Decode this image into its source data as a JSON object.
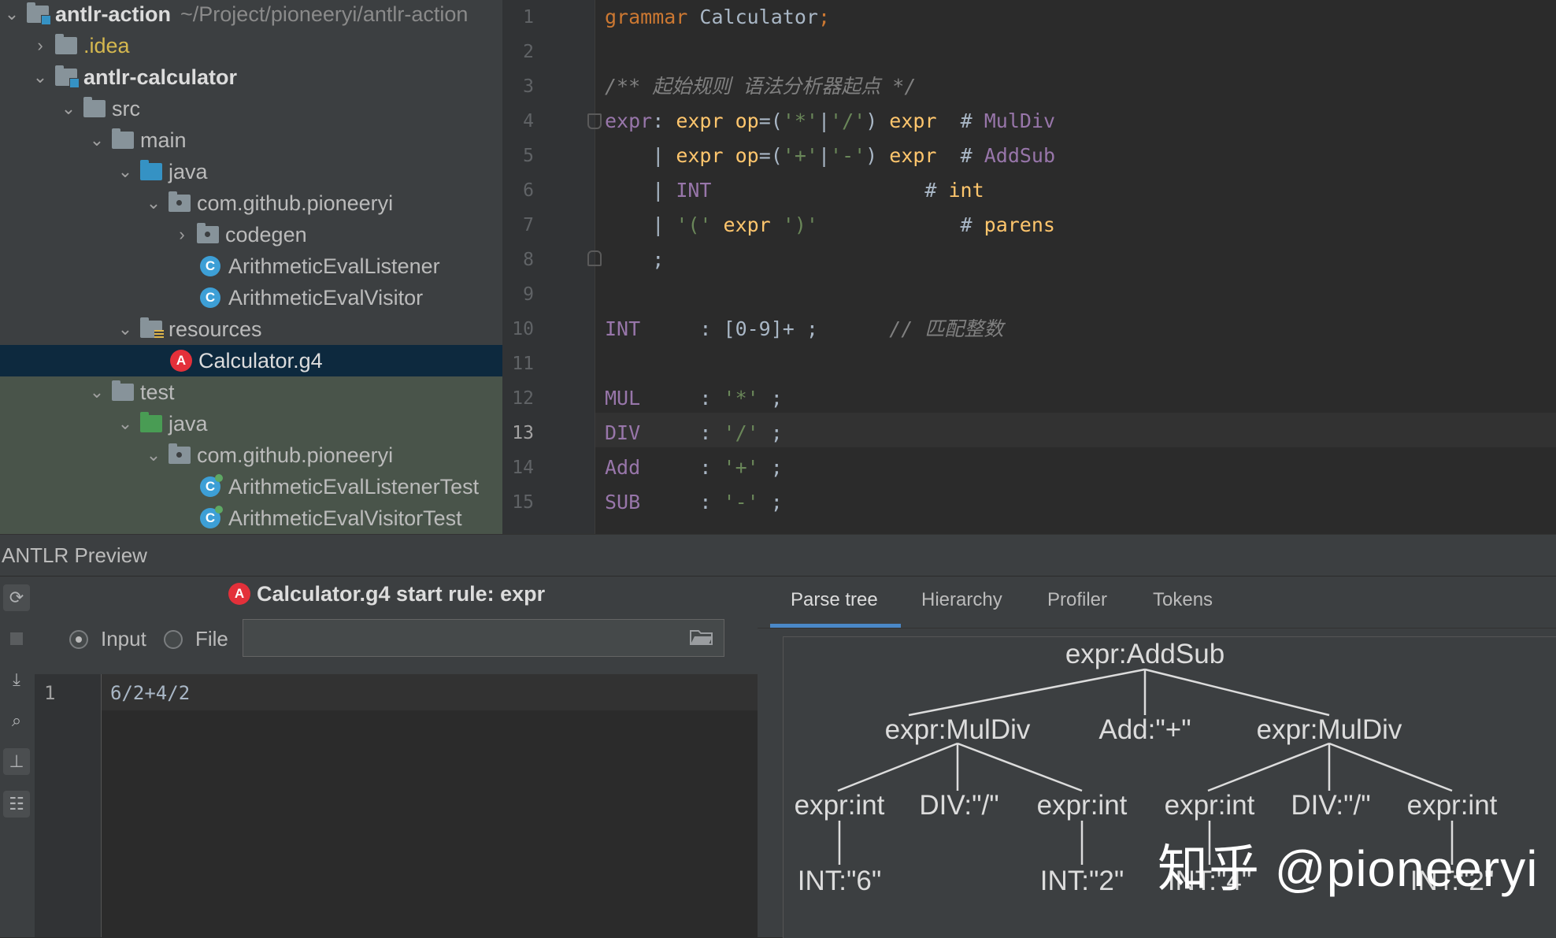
{
  "project_tree": {
    "root": {
      "name": "antlr-action",
      "path": "~/Project/pioneeryi/antlr-action"
    },
    "items": [
      {
        "label": ".idea"
      },
      {
        "label": "antlr-calculator"
      },
      {
        "label": "src"
      },
      {
        "label": "main"
      },
      {
        "label": "java"
      },
      {
        "label": "com.github.pioneeryi"
      },
      {
        "label": "codegen"
      },
      {
        "label": "ArithmeticEvalListener"
      },
      {
        "label": "ArithmeticEvalVisitor"
      },
      {
        "label": "resources"
      },
      {
        "label": "Calculator.g4"
      },
      {
        "label": "test"
      },
      {
        "label": "java"
      },
      {
        "label": "com.github.pioneeryi"
      },
      {
        "label": "ArithmeticEvalListenerTest"
      },
      {
        "label": "ArithmeticEvalVisitorTest"
      }
    ],
    "class_icon_letter": "C",
    "antlr_icon_letter": "A"
  },
  "editor": {
    "line_numbers": [
      "1",
      "2",
      "3",
      "4",
      "5",
      "6",
      "7",
      "8",
      "9",
      "10",
      "11",
      "12",
      "13",
      "14",
      "15"
    ],
    "current_line": "13",
    "lines": [
      [
        {
          "t": "grammar ",
          "c": "or"
        },
        {
          "t": "Calculator",
          "c": "fg"
        },
        {
          "t": ";",
          "c": "or"
        }
      ],
      [],
      [
        {
          "t": "/** 起始规则 语法分析器起点 */",
          "c": "cm"
        }
      ],
      [
        {
          "t": "expr",
          "c": "pu"
        },
        {
          "t": ": ",
          "c": "fg"
        },
        {
          "t": "expr ",
          "c": "ye"
        },
        {
          "t": "op",
          "c": "ye"
        },
        {
          "t": "=(",
          "c": "fg"
        },
        {
          "t": "'*'",
          "c": "gr"
        },
        {
          "t": "|",
          "c": "fg"
        },
        {
          "t": "'/'",
          "c": "gr"
        },
        {
          "t": ") ",
          "c": "fg"
        },
        {
          "t": "expr",
          "c": "ye"
        },
        {
          "t": "  # ",
          "c": "fg"
        },
        {
          "t": "MulDiv",
          "c": "pu"
        }
      ],
      [
        {
          "t": "    | ",
          "c": "fg"
        },
        {
          "t": "expr ",
          "c": "ye"
        },
        {
          "t": "op",
          "c": "ye"
        },
        {
          "t": "=(",
          "c": "fg"
        },
        {
          "t": "'+'",
          "c": "gr"
        },
        {
          "t": "|",
          "c": "fg"
        },
        {
          "t": "'-'",
          "c": "gr"
        },
        {
          "t": ") ",
          "c": "fg"
        },
        {
          "t": "expr",
          "c": "ye"
        },
        {
          "t": "  # ",
          "c": "fg"
        },
        {
          "t": "AddSub",
          "c": "pu"
        }
      ],
      [
        {
          "t": "    | ",
          "c": "fg"
        },
        {
          "t": "INT",
          "c": "pu"
        },
        {
          "t": "                  # ",
          "c": "fg"
        },
        {
          "t": "int",
          "c": "in"
        }
      ],
      [
        {
          "t": "    | ",
          "c": "fg"
        },
        {
          "t": "'('",
          "c": "gr"
        },
        {
          "t": " expr ",
          "c": "ye"
        },
        {
          "t": "')'",
          "c": "gr"
        },
        {
          "t": "            # ",
          "c": "fg"
        },
        {
          "t": "parens",
          "c": "in"
        }
      ],
      [
        {
          "t": "    ;",
          "c": "fg"
        }
      ],
      [],
      [
        {
          "t": "INT",
          "c": "pu"
        },
        {
          "t": "     : [0-9]+ ;      ",
          "c": "fg"
        },
        {
          "t": "// 匹配整数",
          "c": "cm"
        }
      ],
      [],
      [
        {
          "t": "MUL",
          "c": "pu"
        },
        {
          "t": "     : ",
          "c": "fg"
        },
        {
          "t": "'*'",
          "c": "gr"
        },
        {
          "t": " ;",
          "c": "fg"
        }
      ],
      [
        {
          "t": "DIV",
          "c": "pu"
        },
        {
          "t": "     : ",
          "c": "fg"
        },
        {
          "t": "'/'",
          "c": "gr"
        },
        {
          "t": " ;",
          "c": "fg"
        }
      ],
      [
        {
          "t": "Add",
          "c": "pu"
        },
        {
          "t": "     : ",
          "c": "fg"
        },
        {
          "t": "'+'",
          "c": "gr"
        },
        {
          "t": " ;",
          "c": "fg"
        }
      ],
      [
        {
          "t": "SUB",
          "c": "pu"
        },
        {
          "t": "     : ",
          "c": "fg"
        },
        {
          "t": "'-'",
          "c": "gr"
        },
        {
          "t": " ;",
          "c": "fg"
        }
      ]
    ]
  },
  "preview": {
    "title": "ANTLR Preview",
    "start_rule": "Calculator.g4 start rule: expr",
    "input_radio": "Input",
    "file_radio": "File",
    "input_line_number": "1",
    "input_text": "6/2+4/2",
    "tabs": [
      "Parse tree",
      "Hierarchy",
      "Profiler",
      "Tokens"
    ],
    "active_tab": "Parse tree",
    "tool_icons": [
      "refresh-icon",
      "stop-icon",
      "download-icon",
      "search-icon",
      "hierarchy-icon",
      "tree-icon"
    ]
  },
  "parse_tree": {
    "root": "expr:AddSub",
    "level1": [
      "expr:MulDiv",
      "Add:\"+\"",
      "expr:MulDiv"
    ],
    "level2": [
      "expr:int",
      "DIV:\"/\"",
      "expr:int",
      "expr:int",
      "DIV:\"/\"",
      "expr:int"
    ],
    "level3": [
      "INT:\"6\"",
      "INT:\"2\"",
      "INT:\"4\"",
      "INT:\"2\""
    ]
  },
  "watermark": "知乎 @pioneeryi",
  "colors": {
    "accent": "#4a88c7",
    "selection": "#0d293e",
    "test_bg": "#49544a"
  }
}
